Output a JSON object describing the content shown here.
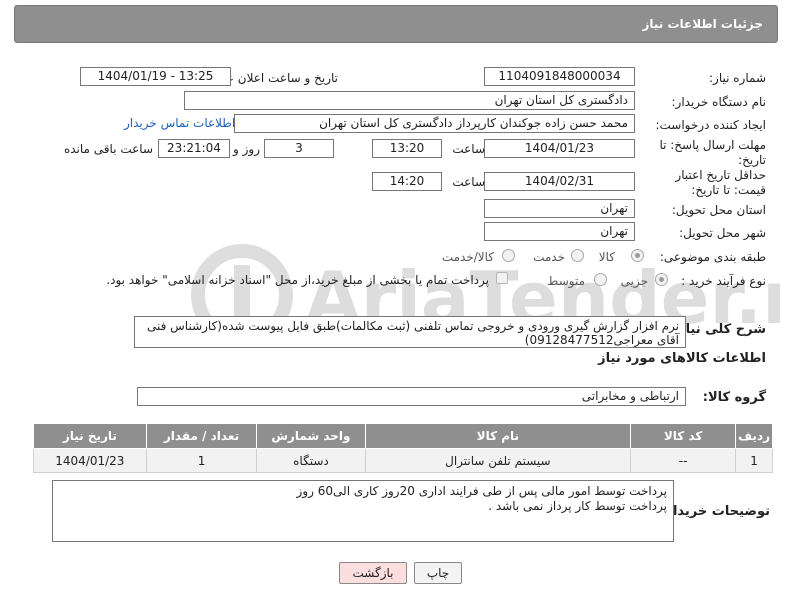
{
  "panel": {
    "title": "جزئیات اطلاعات نیاز"
  },
  "fields": {
    "need_number_label": "شماره نیاز:",
    "need_number": "1104091848000034",
    "announce_label": "تاریخ و ساعت اعلان عمومی:",
    "announce_value": "1404/01/19 - 13:25",
    "buyer_org_label": "نام دستگاه خریدار:",
    "buyer_org": "دادگستری کل استان تهران",
    "creator_label": "ایجاد کننده درخواست:",
    "creator": "محمد حسن زاده جوکندان کارپرداز دادگستری کل استان تهران",
    "buyer_contact_link": "اطلاعات تماس خریدار",
    "reply_deadline_label": "مهلت ارسال پاسخ: تا تاریخ:",
    "reply_date": "1404/01/23",
    "time_label": "ساعت",
    "reply_time": "13:20",
    "days_value": "3",
    "days_label": "روز و",
    "remaining_time": "23:21:04",
    "remaining_label": "ساعت باقی مانده",
    "price_validity_label": "حداقل تاریخ اعتبار قیمت: تا تاریخ:",
    "price_date": "1404/02/31",
    "price_time": "14:20",
    "province_label": "استان محل تحویل:",
    "province": "تهران",
    "city_label": "شهر محل تحویل:",
    "city": "تهران",
    "category_label": "طبقه بندی موضوعی:",
    "category_options": [
      "کالا",
      "خدمت",
      "کالا/خدمت"
    ],
    "process_label": "نوع فرآیند خرید :",
    "process_options": [
      "جزیی",
      "متوسط"
    ],
    "payment_note": "پرداخت تمام یا بخشی از مبلغ خرید،از محل \"اسناد خزانه اسلامی\" خواهد بود."
  },
  "description": {
    "label": "شرح کلی نیاز:",
    "text": "نرم افزار گزارش گیری ورودی و خروجی تماس تلفنی (ثبت مکالمات)طبق فایل پیوست شده(کارشناس فنی آقای معراجی09128477512)"
  },
  "goods_section": {
    "title": "اطلاعات کالاهای مورد نیاز",
    "group_label": "گروه کالا:",
    "group_value": "ارتباطی و مخابراتی"
  },
  "table": {
    "headers": [
      "ردیف",
      "کد کالا",
      "نام کالا",
      "واحد شمارش",
      "تعداد / مقدار",
      "تاریخ نیاز"
    ],
    "rows": [
      [
        "1",
        "--",
        "سیستم تلفن سانترال",
        "دستگاه",
        "1",
        "1404/01/23"
      ]
    ]
  },
  "buyer_notes": {
    "label": "توضیحات خریدار:",
    "line1": "پرداخت توسط امور مالی پس از طی فرایند اداری 20روز کاری الی60 روز",
    "line2": "پرداخت توسط کار پرداز نمی باشد ."
  },
  "buttons": {
    "print": "چاپ",
    "back": "بازگشت"
  },
  "watermark": {
    "text": "AriaTender.neT"
  }
}
